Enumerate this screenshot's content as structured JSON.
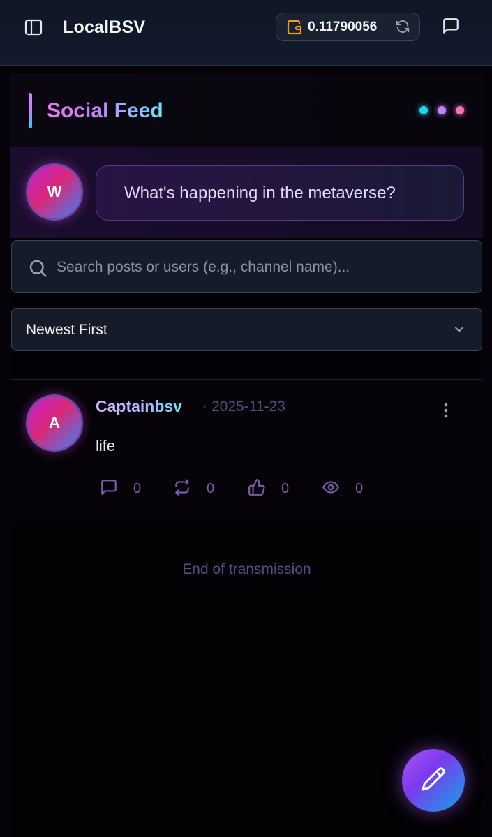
{
  "header": {
    "app_title": "LocalBSV",
    "wallet_balance": "0.11790056",
    "sidebar_toggle_icon": "sidebar-panel-icon",
    "wallet_icon": "wallet-icon",
    "refresh_icon": "refresh-icon",
    "chat_icon": "message-square-icon"
  },
  "feed": {
    "title": "Social Feed",
    "status_dots": [
      "#22d3ee",
      "#c084fc",
      "#f472b6"
    ]
  },
  "composer": {
    "avatar_initial": "W",
    "placeholder": "What's happening in the metaverse?"
  },
  "search": {
    "placeholder": "Search posts or users (e.g., channel name)...",
    "value": ""
  },
  "sort": {
    "selected": "Newest First"
  },
  "posts": [
    {
      "avatar_initial": "A",
      "author": "Captainbsv",
      "separator": "·",
      "date": "2025-11-23",
      "body": "life",
      "comments": "0",
      "reposts": "0",
      "likes": "0",
      "views": "0"
    }
  ],
  "end_message": "End of transmission",
  "colors": {
    "accent_purple": "#a855f7",
    "accent_pink": "#e879f9",
    "accent_cyan": "#22d3ee",
    "wallet_orange": "#f59e0b",
    "muted_text": "#5b4a86"
  }
}
